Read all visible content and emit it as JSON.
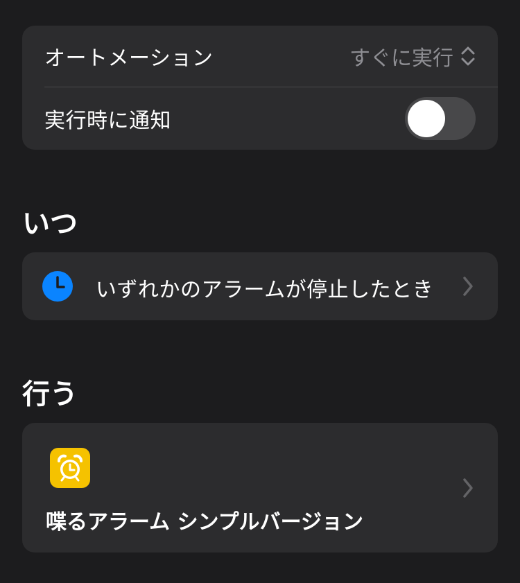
{
  "settings": {
    "automation_label": "オートメーション",
    "automation_value": "すぐに実行",
    "notify_label": "実行時に通知",
    "notify_enabled": false
  },
  "when": {
    "title": "いつ",
    "trigger_label": "いずれかのアラームが停止したとき",
    "trigger_icon": "clock-icon",
    "trigger_icon_color": "#0a84ff"
  },
  "do": {
    "title": "行う",
    "action_label": "喋るアラーム シンプルバージョン",
    "action_icon": "alarm-clock-icon",
    "action_icon_color": "#f5c200"
  }
}
